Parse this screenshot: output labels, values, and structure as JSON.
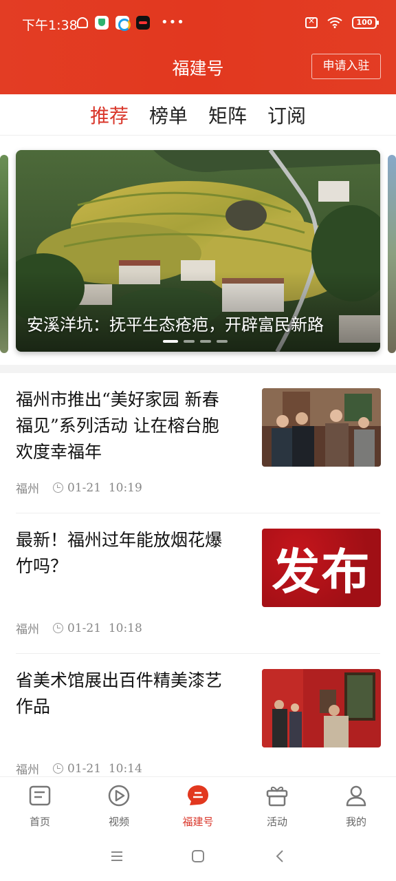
{
  "status_bar": {
    "time": "下午1:38",
    "battery": "100"
  },
  "header": {
    "title": "福建号",
    "apply_button": "申请入驻"
  },
  "tabs": [
    {
      "label": "推荐",
      "active": true
    },
    {
      "label": "榜单",
      "active": false
    },
    {
      "label": "矩阵",
      "active": false
    },
    {
      "label": "订阅",
      "active": false
    }
  ],
  "carousel": {
    "caption": "安溪洋坑：抚平生态疮疤，开辟富民新路",
    "slide_count": 4,
    "active_index": 0
  },
  "news": [
    {
      "title": "福州市推出“美好家园 新春福见”系列活动 让在榕台胞欢度幸福年",
      "source": "福州",
      "time": "01-21  10:19"
    },
    {
      "title": "最新！福州过年能放烟花爆竹吗？",
      "source": "福州",
      "time": "01-21  10:18",
      "thumb_text": "发布"
    },
    {
      "title": "省美术馆展出百件精美漆艺作品",
      "source": "福州",
      "time": "01-21  10:14"
    }
  ],
  "bottom_nav": [
    {
      "label": "首页",
      "icon": "home-icon",
      "active": false
    },
    {
      "label": "视频",
      "icon": "video-icon",
      "active": false
    },
    {
      "label": "福建号",
      "icon": "fujianhao-icon",
      "active": true
    },
    {
      "label": "活动",
      "icon": "gift-icon",
      "active": false
    },
    {
      "label": "我的",
      "icon": "profile-icon",
      "active": false
    }
  ],
  "colors": {
    "brand_red": "#e2381f",
    "active_text": "#d9362a"
  }
}
